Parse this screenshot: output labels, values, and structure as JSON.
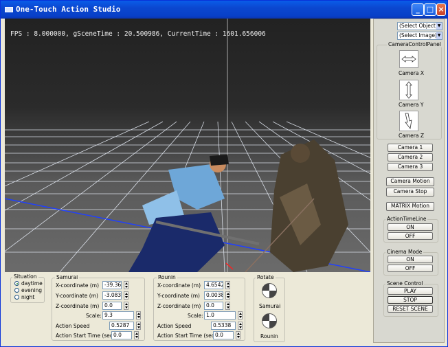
{
  "window": {
    "title": "One-Touch Action Studio"
  },
  "viewport": {
    "fps_text": "FPS : 8.000000, gSceneTime : 20.500986, CurrentTime : 1601.656006"
  },
  "right_panel": {
    "select_object": "(Select Object)",
    "select_image": "(Select Image)",
    "camera_panel_title": "CameraControlPanel",
    "camera_x": "Camera X",
    "camera_y": "Camera Y",
    "camera_z": "Camera Z",
    "camera1": "Camera 1",
    "camera2": "Camera 2",
    "camera3": "Camera 3",
    "camera_motion": "Camera Motion",
    "camera_stop": "Camera Stop",
    "matrix_motion": "MATRIX Motion",
    "action_timeline_title": "ActionTimeLine",
    "timeline_on": "ON",
    "timeline_off": "OFF",
    "cinema_title": "Cinema Mode",
    "cinema_on": "ON",
    "cinema_off": "OFF",
    "scene_control_title": "Scene Control",
    "play": "PLAY",
    "stop": "STOP",
    "reset": "RESET SCENE"
  },
  "situation": {
    "title": "Situation",
    "options": [
      "daytime",
      "evening",
      "night"
    ],
    "selected": "daytime"
  },
  "samurai": {
    "title": "Samurai",
    "x_label": "X-coordinate (m)",
    "x_value": "-39.36",
    "y_label": "Y-coordinate (m)",
    "y_value": "-3.083",
    "z_label": "Z-coordinate (m)",
    "z_value": "0.0",
    "scale_label": "Scale:",
    "scale_value": "9.3",
    "speed_label": "Action Speed",
    "speed_value": "0.5287",
    "start_label": "Action Start Time (sec)",
    "start_value": "0.0"
  },
  "rounin": {
    "title": "Rounin",
    "x_label": "X-coordinate (m)",
    "x_value": "4.6542",
    "y_label": "Y-coordinate (m)",
    "y_value": "0.0038",
    "z_label": "Z-coordinate (m)",
    "z_value": "0.0",
    "scale_label": "Scale:",
    "scale_value": "1.0",
    "speed_label": "Action Speed",
    "speed_value": "0.5338",
    "start_label": "Action Start Time (sec)",
    "start_value": "0.0"
  },
  "rotate": {
    "title": "Rotate",
    "samurai": "Samurai",
    "rounin": "Rounin"
  },
  "colors": {
    "titlebar": "#0a5ce8",
    "grid": "#e8eef8",
    "axis_blue": "#2040ff",
    "axis_red": "#ff2020"
  }
}
